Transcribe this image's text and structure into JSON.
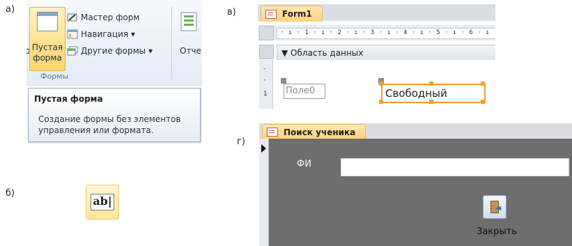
{
  "labels": {
    "a": "а)",
    "b": "б)",
    "c": "в)",
    "d": "г)"
  },
  "ribbon": {
    "cut_left": "ор",
    "big_button_line1": "Пустая",
    "big_button_line2": "форма",
    "items": [
      {
        "label": "Мастер форм"
      },
      {
        "label": "Навигация ▾"
      },
      {
        "label": "Другие формы ▾"
      }
    ],
    "cut_right": "Отче",
    "group_label": "Формы",
    "tooltip_title": "Пустая форма",
    "tooltip_body_line1": "Создание формы без элементов",
    "tooltip_body_line2": "управления или формата."
  },
  "textbox_tool": {
    "glyph": "ab|"
  },
  "form_design": {
    "tab_title": "Form1",
    "ruler_ticks": [
      "·",
      "ı",
      "·",
      "1",
      "·",
      "ı",
      "·",
      "2",
      "·",
      "ı",
      "·",
      "3",
      "·",
      "ı",
      "·",
      "4",
      "·",
      "ı",
      "·",
      "5",
      "·",
      "ı",
      "·",
      "6",
      "·",
      "ı"
    ],
    "section_label": "Область данных",
    "vertical_ticks": [
      "-",
      "-",
      "1"
    ],
    "field0": "Поле0",
    "free_field": "Свободный"
  },
  "search_form": {
    "tab_title": "Поиск ученика",
    "field_label": "ФИ",
    "field_value": "",
    "close_button_label": "Закрыть"
  }
}
